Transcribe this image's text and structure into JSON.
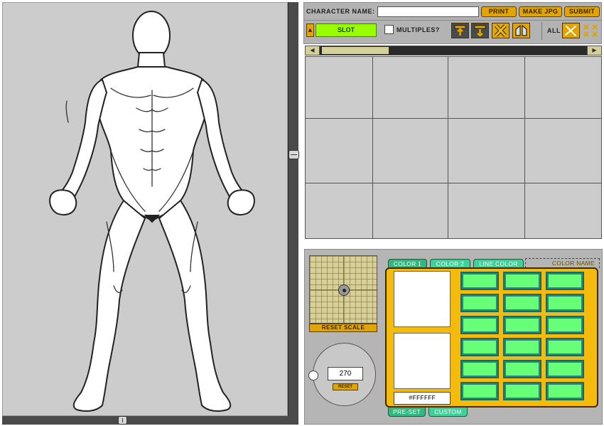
{
  "toolbar": {
    "name_label": "CHARACTER NAME:",
    "name_value": "",
    "print_label": "PRINT",
    "make_jpg_label": "MAKE JPG",
    "submit_label": "SUBMIT",
    "slot_label": "SLOT",
    "multiples_label": "MULTIPLES?",
    "all_label": "ALL",
    "icons": [
      "layer-up-icon",
      "layer-down-icon",
      "delete-x-icon",
      "mirror-icon",
      "scatter-icon",
      "grid-icon"
    ]
  },
  "slot_strip": {
    "left_arrow": "◀",
    "right_arrow": "▶"
  },
  "slots": {
    "rows": 3,
    "columns": 4
  },
  "scale": {
    "reset_label": "RESET SCALE"
  },
  "rotation": {
    "angle": "270",
    "reset_label": "RESET"
  },
  "color_tabs": {
    "color1": "COLOR 1",
    "color2": "COLOR 2",
    "line_color": "LINE COLOR",
    "color_name": "COLOR NAME"
  },
  "color": {
    "hex": "#FFFFFF",
    "swatch1": "#ffffff",
    "swatch2": "#ffffff",
    "palette_color": "#66ff77",
    "panel_color": "#f4bb0c"
  },
  "palette_tabs": {
    "preset": "PRE-SET",
    "custom": "CUSTOM"
  }
}
